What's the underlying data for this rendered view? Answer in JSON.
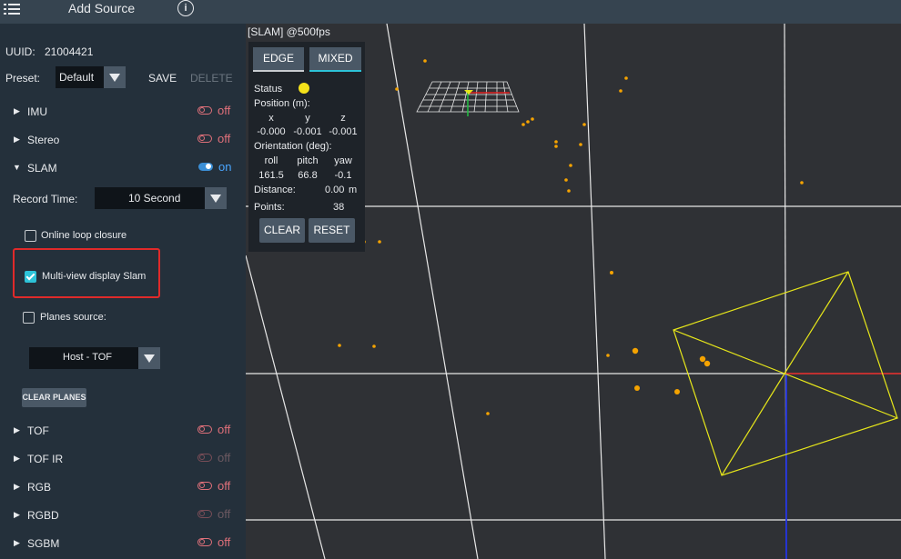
{
  "topbar": {
    "title": "Add Source",
    "menu_icon": "menu-icon",
    "info_icon": "info-icon",
    "info_glyph": "i"
  },
  "sidebar": {
    "uuid_label": "UUID:",
    "uuid_value": "21004421",
    "preset_label": "Preset:",
    "preset_value": "Default",
    "save_label": "SAVE",
    "delete_label": "DELETE",
    "arrow_collapsed": "▶",
    "arrow_expanded": "▼",
    "streams_top": [
      {
        "name": "IMU",
        "state": "off"
      },
      {
        "name": "Stereo",
        "state": "off"
      },
      {
        "name": "SLAM",
        "state": "on"
      }
    ],
    "record_time_label": "Record Time:",
    "record_time_value": "10 Second",
    "online_loop_closure": "Online loop closure",
    "multi_view_slam": "Multi-view display Slam",
    "planes_source": "Planes source:",
    "planes_source_value": "Host - TOF",
    "clear_planes": "CLEAR PLANES",
    "streams_bottom": [
      {
        "name": "TOF",
        "state": "off"
      },
      {
        "name": "TOF IR",
        "state": "off"
      },
      {
        "name": "RGB",
        "state": "off"
      },
      {
        "name": "RGBD",
        "state": "off"
      },
      {
        "name": "SGBM",
        "state": "off"
      }
    ]
  },
  "viewport": {
    "title": "[SLAM]  @500fps",
    "edge_tab": "EDGE",
    "mixed_tab": "MIXED",
    "status_label": "Status",
    "position_label": "Position (m):",
    "pos_headers": [
      "x",
      "y",
      "z"
    ],
    "pos_values": [
      "-0.000",
      "-0.001",
      "-0.001"
    ],
    "orientation_label": "Orientation (deg):",
    "ori_headers": [
      "roll",
      "pitch",
      "yaw"
    ],
    "ori_values": [
      "161.5",
      "66.8",
      "-0.1"
    ],
    "distance_label": "Distance:",
    "distance_value": "0.00",
    "distance_unit": "m",
    "points_label": "Points:",
    "points_value": "38",
    "clear_btn": "CLEAR",
    "reset_btn": "RESET"
  },
  "colors": {
    "accent": "#2dc3d8",
    "off": "#e0707a",
    "on": "#4aa6ff",
    "points": "#f5a300",
    "frustum": "#e6e61a",
    "x_axis": "#e02020",
    "z_axis": "#2030e0"
  }
}
